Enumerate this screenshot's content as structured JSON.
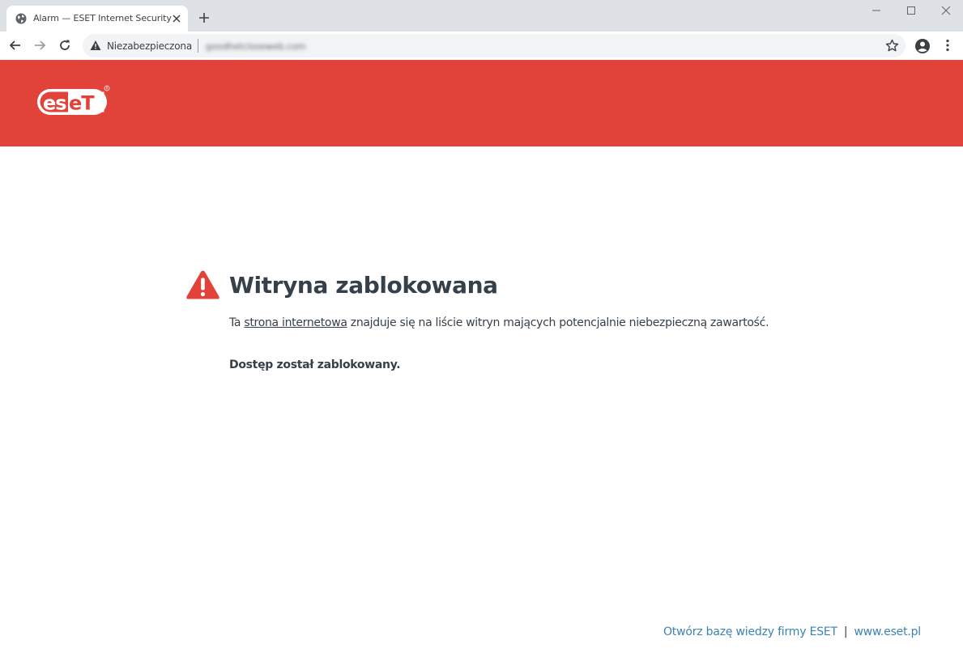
{
  "browser": {
    "tab_title": "Alarm — ESET Internet Security",
    "security_label": "Niezabezpieczona",
    "url": "goodhetcloseweb.com"
  },
  "page": {
    "logo_text": "eset",
    "heading": "Witryna zablokowana",
    "description_prefix": "Ta",
    "description_link": "strona internetowa",
    "description_suffix": "znajduje się na liście witryn mających potencjalnie niebezpieczną zawartość.",
    "blocked_message": "Dostęp został zablokowany."
  },
  "footer": {
    "knowledge_base_link": "Otwórz bazę wiedzy firmy ESET",
    "divider": "|",
    "site_link": "www.eset.pl"
  },
  "colors": {
    "brand_red": "#e1433a",
    "heading_text": "#36404a",
    "link_blue": "#3a83b5"
  }
}
